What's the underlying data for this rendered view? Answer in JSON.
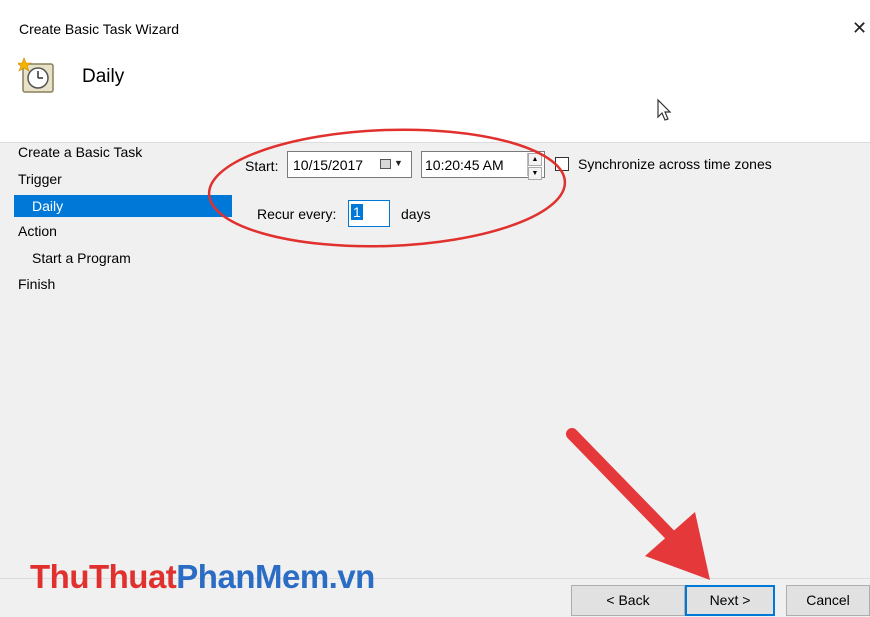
{
  "window": {
    "title": "Create Basic Task Wizard",
    "close_glyph": "✕"
  },
  "header": {
    "title": "Daily",
    "icon": "clock-task-icon"
  },
  "nav": {
    "items": [
      {
        "label": "Create a Basic Task",
        "selected": false
      },
      {
        "label": "Trigger",
        "selected": false
      },
      {
        "label": "Daily",
        "selected": true
      },
      {
        "label": "Action",
        "selected": false
      },
      {
        "label": "Start a Program",
        "selected": false
      },
      {
        "label": "Finish",
        "selected": false
      }
    ]
  },
  "form": {
    "start_label": "Start:",
    "date_value": "10/15/2017",
    "time_value": "10:20:45 AM",
    "sync_label": "Synchronize across time zones",
    "sync_checked": false,
    "recur_label": "Recur every:",
    "recur_value": "1",
    "recur_unit": "days"
  },
  "buttons": {
    "back": "< Back",
    "next": "Next >",
    "cancel": "Cancel"
  },
  "watermark": {
    "part1": "ThuThuat",
    "part2": "PhanMem.vn"
  },
  "colors": {
    "accent": "#0078d7",
    "annotation_red": "#e0312e",
    "watermark_blue": "#2b6cc4"
  }
}
